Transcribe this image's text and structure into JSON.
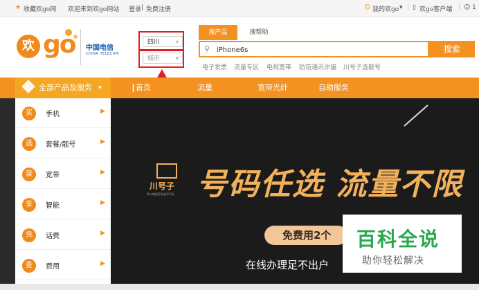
{
  "topbar": {
    "favorite": "收藏欢go网",
    "welcome": "欢迎来到欢go网站",
    "login": "登录",
    "register": "免费注册",
    "login_sep": " | ",
    "my_huango": "我的欢go",
    "client": "欢go客户端",
    "more": "1"
  },
  "header": {
    "logo_huan": "欢",
    "logo_go": "go",
    "telecom_cn": "中国电信",
    "telecom_en": "CHINA TELECOM"
  },
  "location": {
    "province": "四川",
    "city_placeholder": "城市"
  },
  "search": {
    "tab_products": "搜产品",
    "tab_help": "搜帮助",
    "value": "iPhone6s",
    "button": "搜索",
    "hot_links": [
      "电子发票",
      "流量专区",
      "电视宽带",
      "防范通讯诈骗",
      "川号子选靓号"
    ]
  },
  "nav": {
    "all_products": "全部产品及服务",
    "items": [
      "首页",
      "流量",
      "宽带光纤",
      "自助服务"
    ]
  },
  "sidebar": {
    "items": [
      {
        "icon": "买",
        "label": "手机"
      },
      {
        "icon": "选",
        "label": "套餐/靓号"
      },
      {
        "icon": "装",
        "label": "宽带"
      },
      {
        "icon": "享",
        "label": "智能"
      },
      {
        "icon": "充",
        "label": "话费"
      },
      {
        "icon": "查",
        "label": "费用"
      }
    ]
  },
  "banner": {
    "brand": "川号子",
    "brand_sub": "四川电信官方选号平台",
    "headline": "号码任选 流量不限",
    "pill": "免费用2个",
    "subline": "在线办理足不出户"
  },
  "watermark": {
    "title": "百科全说",
    "sub": "助你轻松解决"
  },
  "colors": {
    "orange": "#f39121",
    "annotation_red": "#e02020",
    "watermark_green": "#2aa84f"
  }
}
